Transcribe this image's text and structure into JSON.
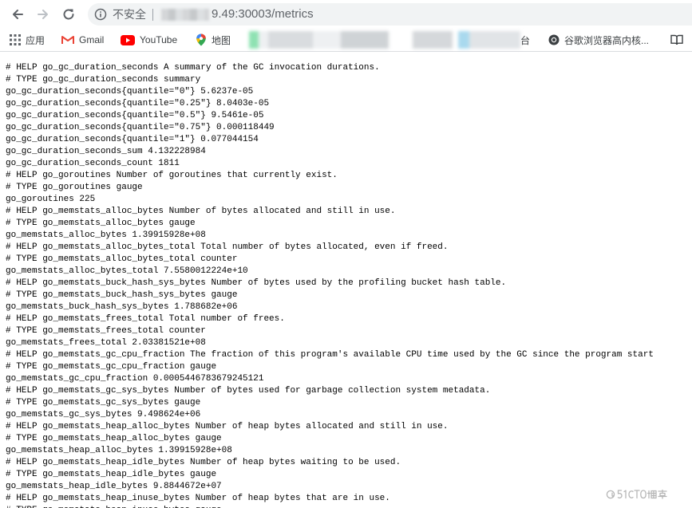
{
  "browser": {
    "insecure_label": "不安全",
    "url_visible": "9.49:30003/metrics",
    "bookmarks": [
      {
        "label": "应用",
        "icon": "apps-grid-icon"
      },
      {
        "label": "Gmail",
        "icon": "gmail-icon"
      },
      {
        "label": "YouTube",
        "icon": "youtube-icon"
      },
      {
        "label": "地图",
        "icon": "maps-icon"
      },
      {
        "label": "台",
        "icon": "blurred"
      },
      {
        "label": "谷歌浏览器高内核...",
        "icon": "chrome-icon"
      }
    ]
  },
  "colors": {
    "omnibox_bg": "#f1f3f4",
    "text_gray": "#5f6368",
    "gmail_red": "#ea4335",
    "youtube_red": "#ff0000"
  },
  "watermark": "@51CTO博客",
  "metrics_lines": [
    "# HELP go_gc_duration_seconds A summary of the GC invocation durations.",
    "# TYPE go_gc_duration_seconds summary",
    "go_gc_duration_seconds{quantile=\"0\"} 5.6237e-05",
    "go_gc_duration_seconds{quantile=\"0.25\"} 8.0403e-05",
    "go_gc_duration_seconds{quantile=\"0.5\"} 9.5461e-05",
    "go_gc_duration_seconds{quantile=\"0.75\"} 0.000118449",
    "go_gc_duration_seconds{quantile=\"1\"} 0.077044154",
    "go_gc_duration_seconds_sum 4.132228984",
    "go_gc_duration_seconds_count 1811",
    "# HELP go_goroutines Number of goroutines that currently exist.",
    "# TYPE go_goroutines gauge",
    "go_goroutines 225",
    "# HELP go_memstats_alloc_bytes Number of bytes allocated and still in use.",
    "# TYPE go_memstats_alloc_bytes gauge",
    "go_memstats_alloc_bytes 1.39915928e+08",
    "# HELP go_memstats_alloc_bytes_total Total number of bytes allocated, even if freed.",
    "# TYPE go_memstats_alloc_bytes_total counter",
    "go_memstats_alloc_bytes_total 7.5580012224e+10",
    "# HELP go_memstats_buck_hash_sys_bytes Number of bytes used by the profiling bucket hash table.",
    "# TYPE go_memstats_buck_hash_sys_bytes gauge",
    "go_memstats_buck_hash_sys_bytes 1.788682e+06",
    "# HELP go_memstats_frees_total Total number of frees.",
    "# TYPE go_memstats_frees_total counter",
    "go_memstats_frees_total 2.03381521e+08",
    "# HELP go_memstats_gc_cpu_fraction The fraction of this program's available CPU time used by the GC since the program start",
    "# TYPE go_memstats_gc_cpu_fraction gauge",
    "go_memstats_gc_cpu_fraction 0.0005446783679245121",
    "# HELP go_memstats_gc_sys_bytes Number of bytes used for garbage collection system metadata.",
    "# TYPE go_memstats_gc_sys_bytes gauge",
    "go_memstats_gc_sys_bytes 9.498624e+06",
    "# HELP go_memstats_heap_alloc_bytes Number of heap bytes allocated and still in use.",
    "# TYPE go_memstats_heap_alloc_bytes gauge",
    "go_memstats_heap_alloc_bytes 1.39915928e+08",
    "# HELP go_memstats_heap_idle_bytes Number of heap bytes waiting to be used.",
    "# TYPE go_memstats_heap_idle_bytes gauge",
    "go_memstats_heap_idle_bytes 9.8844672e+07",
    "# HELP go_memstats_heap_inuse_bytes Number of heap bytes that are in use.",
    "# TYPE go_memstats_heap_inuse_bytes gauge"
  ]
}
